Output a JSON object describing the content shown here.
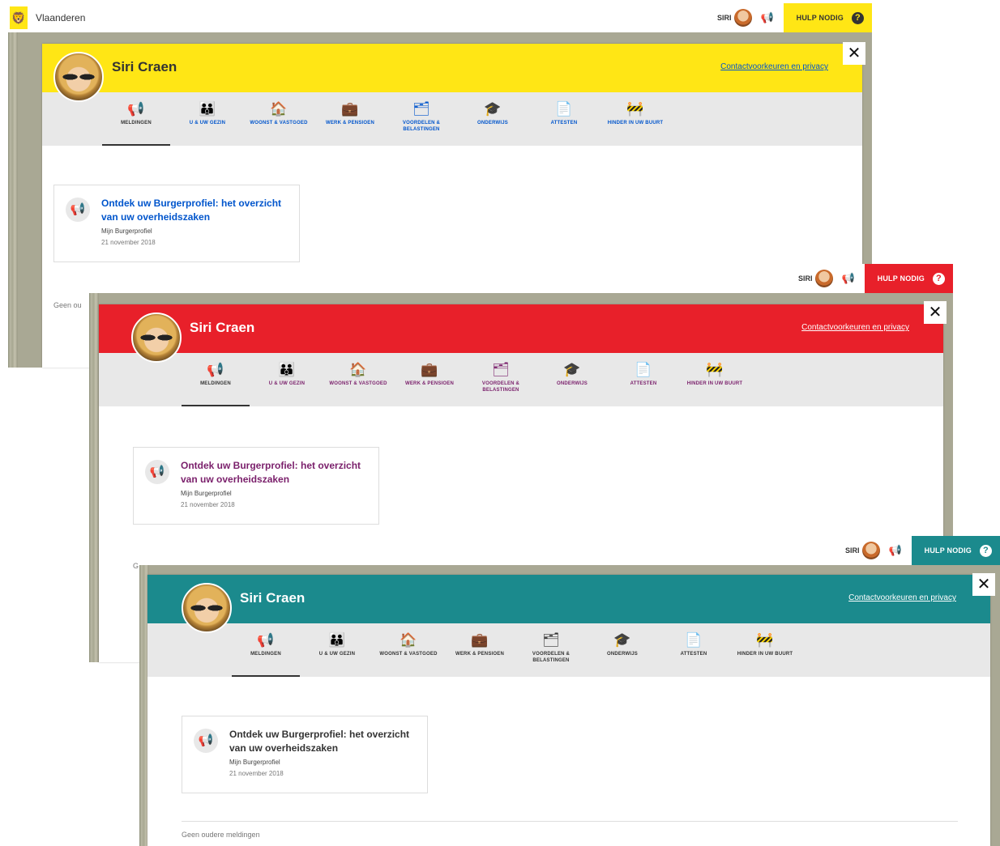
{
  "site": {
    "name": "Vlaanderen"
  },
  "user": {
    "short_name": "SIRI",
    "full_name": "Siri Craen"
  },
  "help_label": "HULP NODIG",
  "help_icon": "?",
  "close_icon": "✕",
  "privacy_link": "Contactvoorkeuren en privacy",
  "nav_items": [
    {
      "label": "MELDINGEN",
      "icon": "megaphone-icon"
    },
    {
      "label": "U & UW GEZIN",
      "icon": "family-icon"
    },
    {
      "label": "WOONST & VASTGOED",
      "icon": "house-icon"
    },
    {
      "label": "WERK & PENSIOEN",
      "icon": "briefcase-icon"
    },
    {
      "label": "VOORDELEN & BELASTINGEN",
      "icon": "documents-icon"
    },
    {
      "label": "ONDERWIJS",
      "icon": "graduation-cap-icon"
    },
    {
      "label": "ATTESTEN",
      "icon": "certificate-icon"
    },
    {
      "label": "HINDER IN UW BUURT",
      "icon": "road-sign-icon"
    }
  ],
  "notification": {
    "title": "Ontdek uw Burgerprofiel: het overzicht van uw overheidszaken",
    "source": "Mijn Burgerprofiel",
    "date": "21 november 2018"
  },
  "older_partial_1": "Geen ou",
  "older_partial_2": "G",
  "older_full": "Geen oudere meldingen",
  "themes": {
    "yellow": {
      "bg": "#ffe615",
      "text": "#333333",
      "accent": "#0055cc"
    },
    "red": {
      "bg": "#e8202a",
      "text": "#ffffff",
      "accent": "#7a1f6b"
    },
    "teal": {
      "bg": "#1b8a8d",
      "text": "#ffffff",
      "accent": "#333333"
    }
  }
}
